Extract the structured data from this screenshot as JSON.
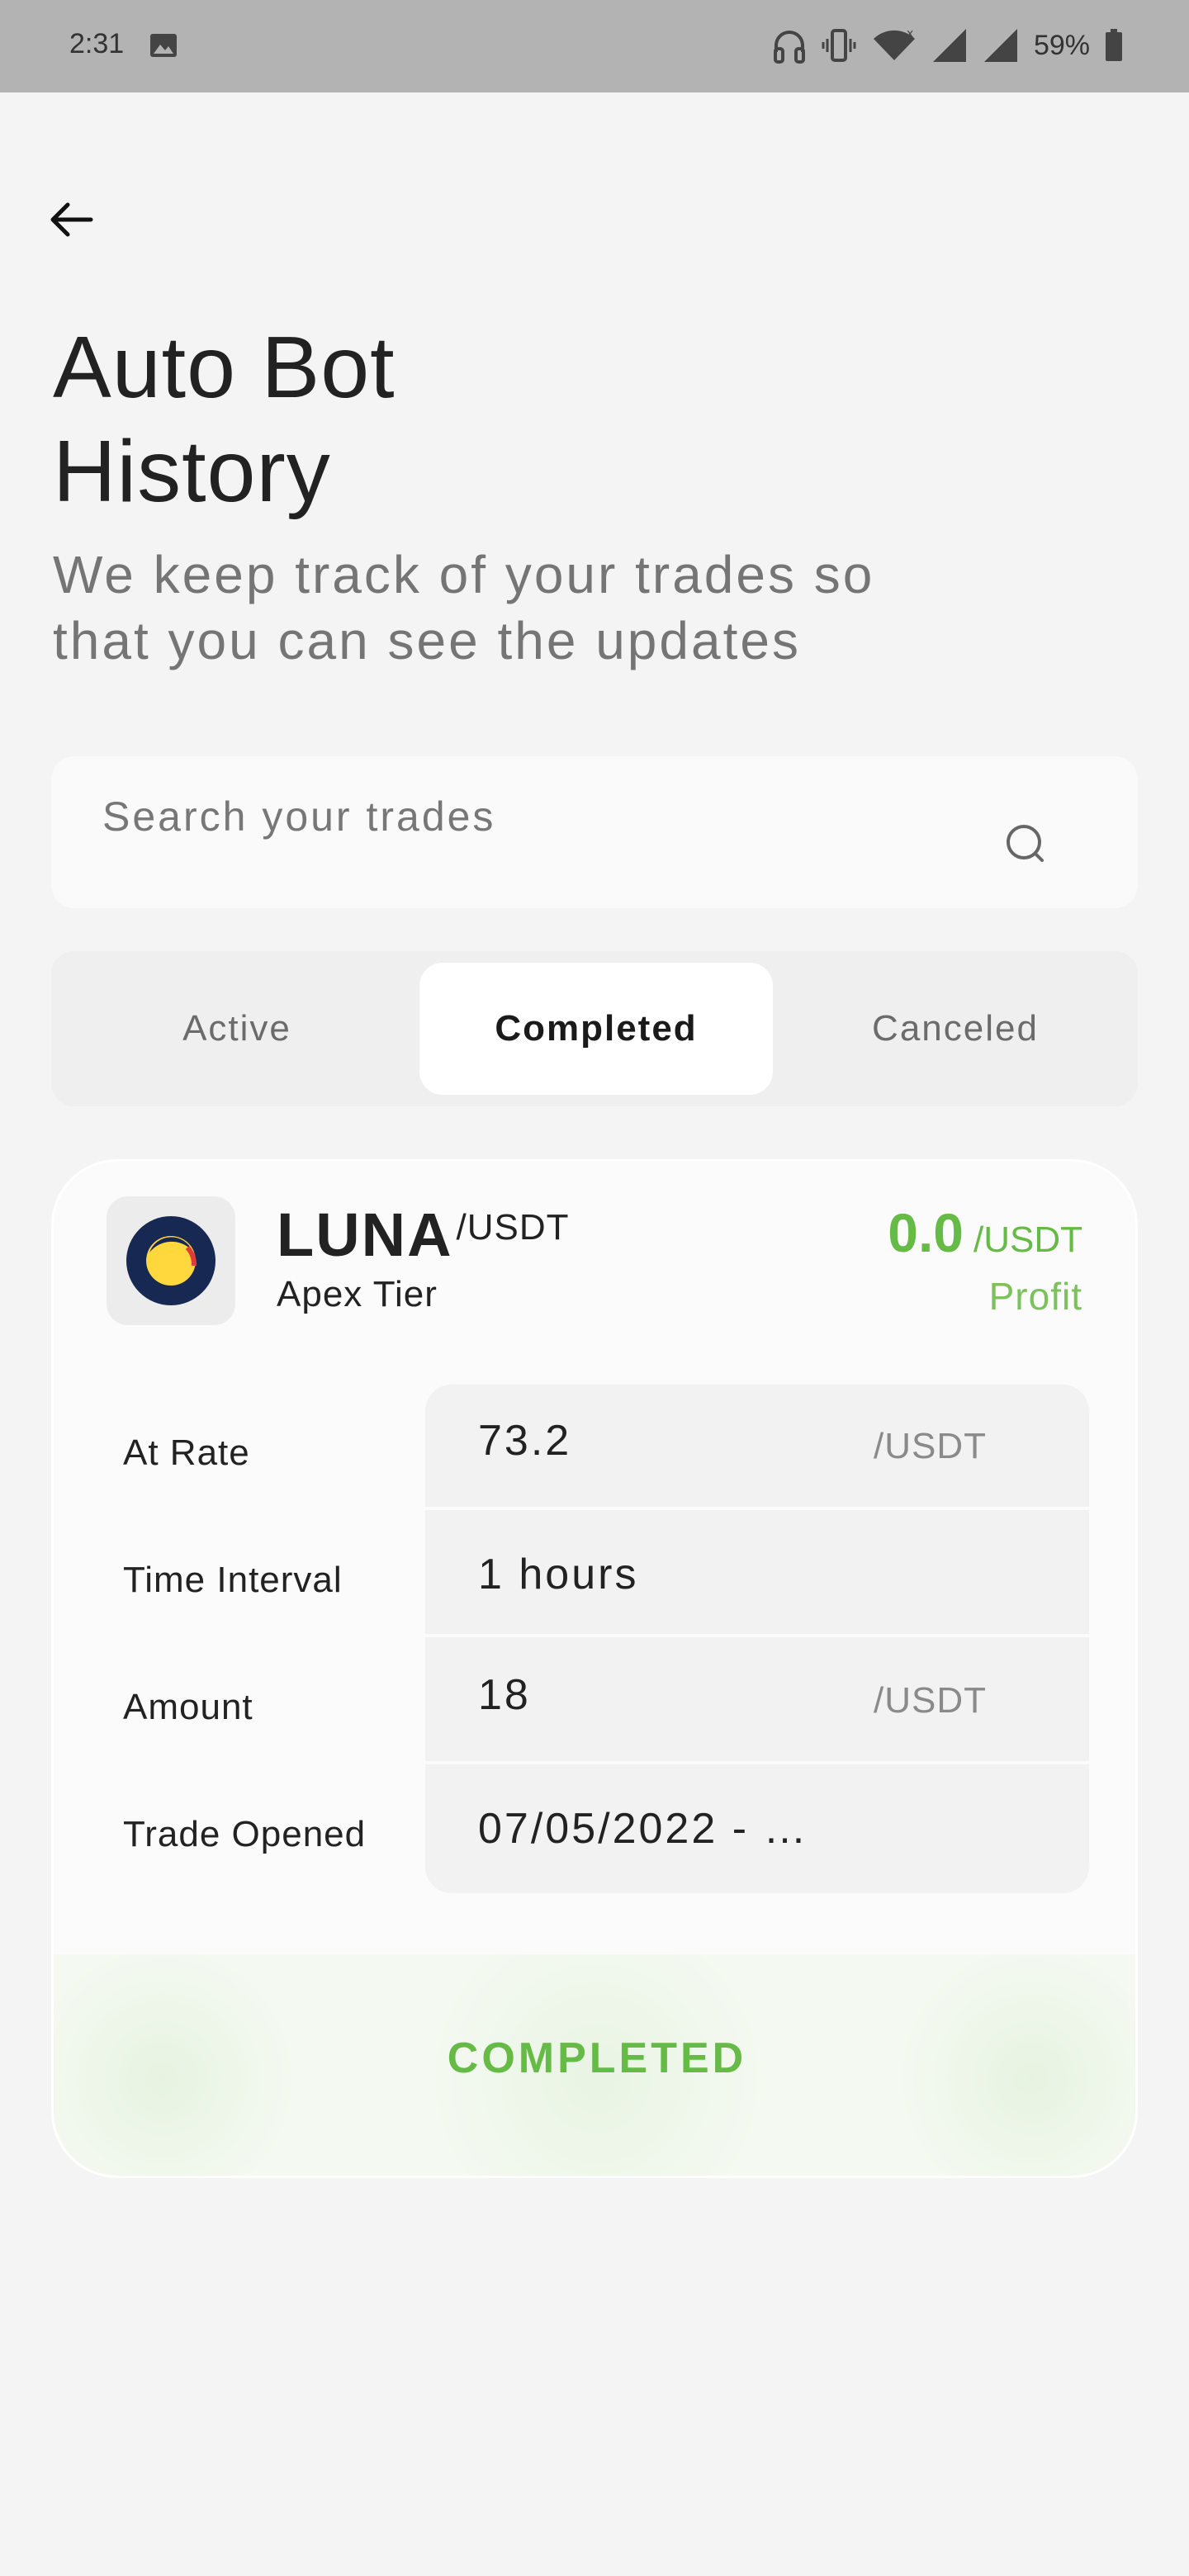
{
  "status_bar": {
    "time": "2:31",
    "battery": "59%"
  },
  "header": {
    "title_line1": "Auto Bot",
    "title_line2": "History",
    "subtitle_line1": "We keep track of your trades so",
    "subtitle_line2": "that you can see the updates"
  },
  "search": {
    "placeholder": "Search your trades"
  },
  "tabs": [
    {
      "label": "Active",
      "selected": false
    },
    {
      "label": "Completed",
      "selected": true
    },
    {
      "label": "Canceled",
      "selected": false
    }
  ],
  "trade": {
    "coin": "LUNA",
    "quote": "/USDT",
    "tier": "Apex Tier",
    "profit_value": "0.0",
    "profit_unit": "/USDT",
    "profit_label": "Profit",
    "rows": [
      {
        "label": "At Rate",
        "value": "73.2",
        "unit": "/USDT"
      },
      {
        "label": "Time Interval",
        "value": "1 hours",
        "unit": ""
      },
      {
        "label": "Amount",
        "value": "18",
        "unit": "/USDT"
      },
      {
        "label": "Trade Opened",
        "value": "07/05/2022 - …",
        "unit": ""
      }
    ],
    "status": "COMPLETED"
  },
  "colors": {
    "accent_green": "#66bb46",
    "status_bar": "#b3b3b3"
  }
}
